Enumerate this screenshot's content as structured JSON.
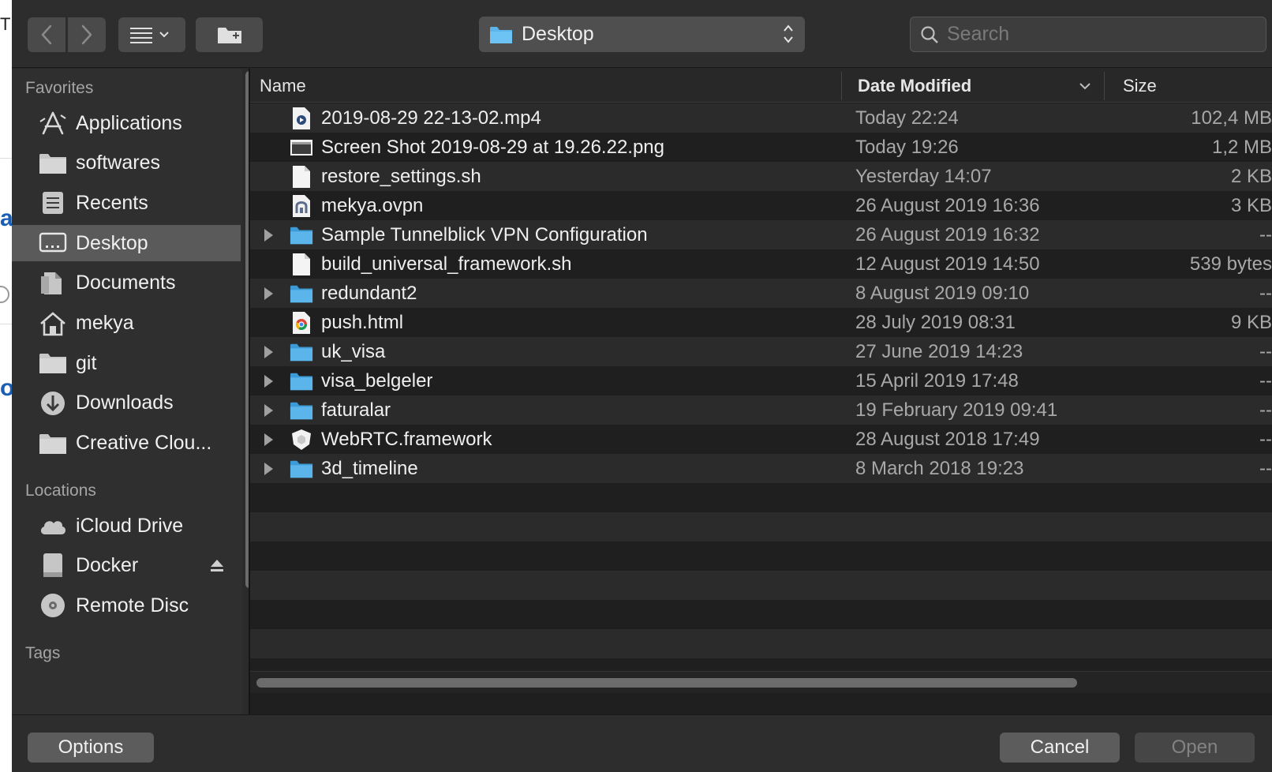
{
  "toolbar": {
    "location": "Desktop",
    "search_placeholder": "Search"
  },
  "sidebar": {
    "favorites_header": "Favorites",
    "favorites": [
      {
        "label": "Applications",
        "icon": "applications-icon"
      },
      {
        "label": "softwares",
        "icon": "folder-icon"
      },
      {
        "label": "Recents",
        "icon": "recents-icon"
      },
      {
        "label": "Desktop",
        "icon": "desktop-icon",
        "selected": true
      },
      {
        "label": "Documents",
        "icon": "documents-icon"
      },
      {
        "label": "mekya",
        "icon": "home-icon"
      },
      {
        "label": "git",
        "icon": "folder-icon"
      },
      {
        "label": "Downloads",
        "icon": "downloads-icon"
      },
      {
        "label": "Creative Clou...",
        "icon": "folder-icon"
      }
    ],
    "locations_header": "Locations",
    "locations": [
      {
        "label": "iCloud Drive",
        "icon": "cloud-icon"
      },
      {
        "label": "Docker",
        "icon": "disk-icon",
        "eject": true
      },
      {
        "label": "Remote Disc",
        "icon": "disc-icon"
      }
    ],
    "tags_header": "Tags"
  },
  "columns": {
    "name": "Name",
    "date": "Date Modified",
    "size": "Size"
  },
  "files": [
    {
      "name": "2019-08-29 22-13-02.mp4",
      "date": "Today 22:24",
      "size": "102,4 MB",
      "kind": "video",
      "folder": false
    },
    {
      "name": "Screen Shot 2019-08-29 at 19.26.22.png",
      "date": "Today 19:26",
      "size": "1,2 MB",
      "kind": "image",
      "folder": false
    },
    {
      "name": "restore_settings.sh",
      "date": "Yesterday 14:07",
      "size": "2 KB",
      "kind": "doc",
      "folder": false
    },
    {
      "name": "mekya.ovpn",
      "date": "26 August 2019 16:36",
      "size": "3 KB",
      "kind": "vpn",
      "folder": false
    },
    {
      "name": "Sample Tunnelblick VPN Configuration",
      "date": "26 August 2019 16:32",
      "size": "--",
      "kind": "folder",
      "folder": true
    },
    {
      "name": "build_universal_framework.sh",
      "date": "12 August 2019 14:50",
      "size": "539 bytes",
      "kind": "doc",
      "folder": false
    },
    {
      "name": "redundant2",
      "date": "8 August 2019 09:10",
      "size": "--",
      "kind": "folder",
      "folder": true
    },
    {
      "name": "push.html",
      "date": "28 July 2019 08:31",
      "size": "9 KB",
      "kind": "chrome",
      "folder": false
    },
    {
      "name": "uk_visa",
      "date": "27 June 2019 14:23",
      "size": "--",
      "kind": "folder",
      "folder": true
    },
    {
      "name": "visa_belgeler",
      "date": "15 April 2019 17:48",
      "size": "--",
      "kind": "folder",
      "folder": true
    },
    {
      "name": "faturalar",
      "date": "19 February 2019 09:41",
      "size": "--",
      "kind": "folder",
      "folder": true
    },
    {
      "name": "WebRTC.framework",
      "date": "28 August 2018 17:49",
      "size": "--",
      "kind": "framework",
      "folder": true
    },
    {
      "name": "3d_timeline",
      "date": "8 March 2018 19:23",
      "size": "--",
      "kind": "folder",
      "folder": true
    }
  ],
  "footer": {
    "options": "Options",
    "cancel": "Cancel",
    "open": "Open"
  },
  "colors": {
    "folder_blue": "#5bb4ea",
    "selection_gray": "#5a5a5a"
  }
}
